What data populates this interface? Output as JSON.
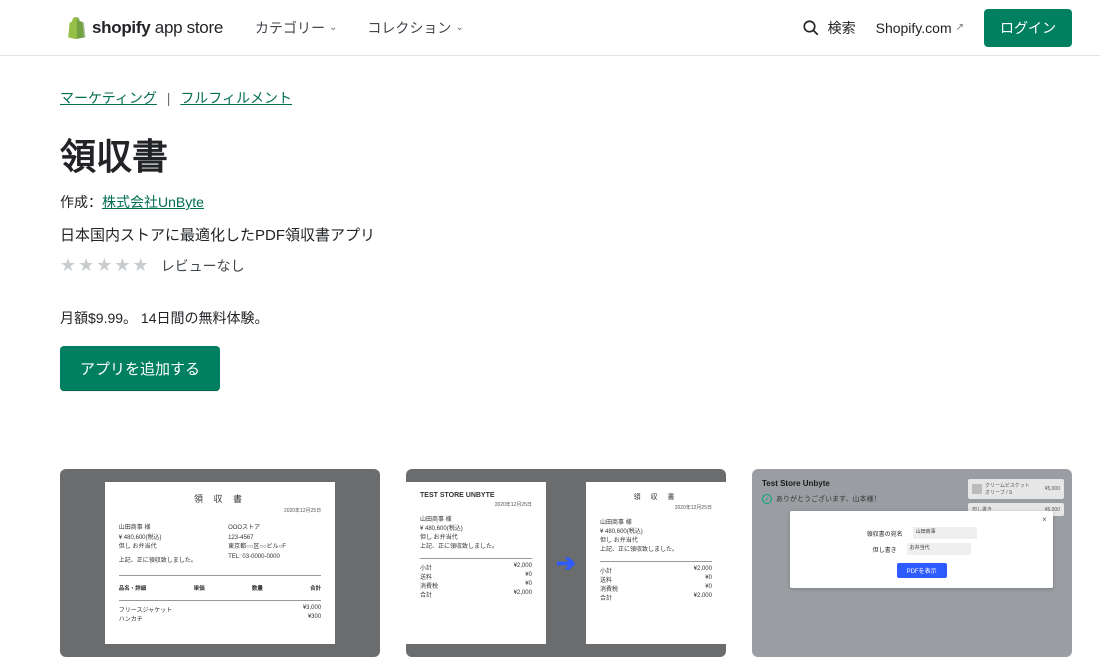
{
  "header": {
    "logo_main": "shopify",
    "logo_sub": "app store",
    "nav": {
      "categories": "カテゴリー",
      "collections": "コレクション"
    },
    "search_label": "検索",
    "shopify_com": "Shopify.com",
    "login": "ログイン"
  },
  "breadcrumbs": {
    "marketing": "マーケティング",
    "fulfillment": "フルフィルメント"
  },
  "app": {
    "title": "領収書",
    "by_prefix": "作成：",
    "developer": "株式会社UnByte",
    "tagline": "日本国内ストアに最適化したPDF領収書アプリ",
    "reviews_label": "レビューなし",
    "price": "月額$9.99。 14日間の無料体験。",
    "add_button": "アプリを追加する"
  },
  "thumb1": {
    "title": "領 収 書",
    "date": "2020年12月25日",
    "left": [
      "山田商事 様",
      "¥ 480,600(税込)",
      "但し お弁当代"
    ],
    "left_note": "上記、正に領収致しました。",
    "right": [
      "OOOストア",
      "123-4567",
      "東京都○○区○○ビル○F",
      "TEL: 03-0000-0000"
    ],
    "table_hdr": [
      "品名・詳細",
      "単価",
      "数量",
      "合計"
    ],
    "items": [
      [
        "フリースジャケット",
        "¥3,000"
      ],
      [
        "ハンカチ",
        "¥300"
      ]
    ]
  },
  "thumb2": {
    "store": "TEST STORE UNBYTE",
    "date": "2020年12月25日",
    "left": [
      "山田商事 様",
      "¥ 480,600(税込)",
      "但し お弁当代",
      "上記、正に領収致しました。"
    ],
    "doc_title": "領 収 書",
    "totals": [
      [
        "小計",
        "¥2,000"
      ],
      [
        "送料",
        "¥0"
      ],
      [
        "消費税",
        "¥0"
      ],
      [
        "合計",
        "¥2,000"
      ]
    ]
  },
  "thumb3": {
    "store": "Test Store Unbyte",
    "thanks": "ありがとうございます、山本様！",
    "modal": {
      "row1_label": "領収書の宛名",
      "row1_value": "山田商事",
      "row2_label": "但し書き",
      "row2_value": "お弁当代",
      "button": "PDFを表示"
    },
    "cards": [
      {
        "title": "クリームビスケット",
        "sub": "オリーブ / S",
        "price": "¥5,000"
      },
      {
        "title": "但し書き",
        "price": "¥5,000"
      }
    ]
  }
}
